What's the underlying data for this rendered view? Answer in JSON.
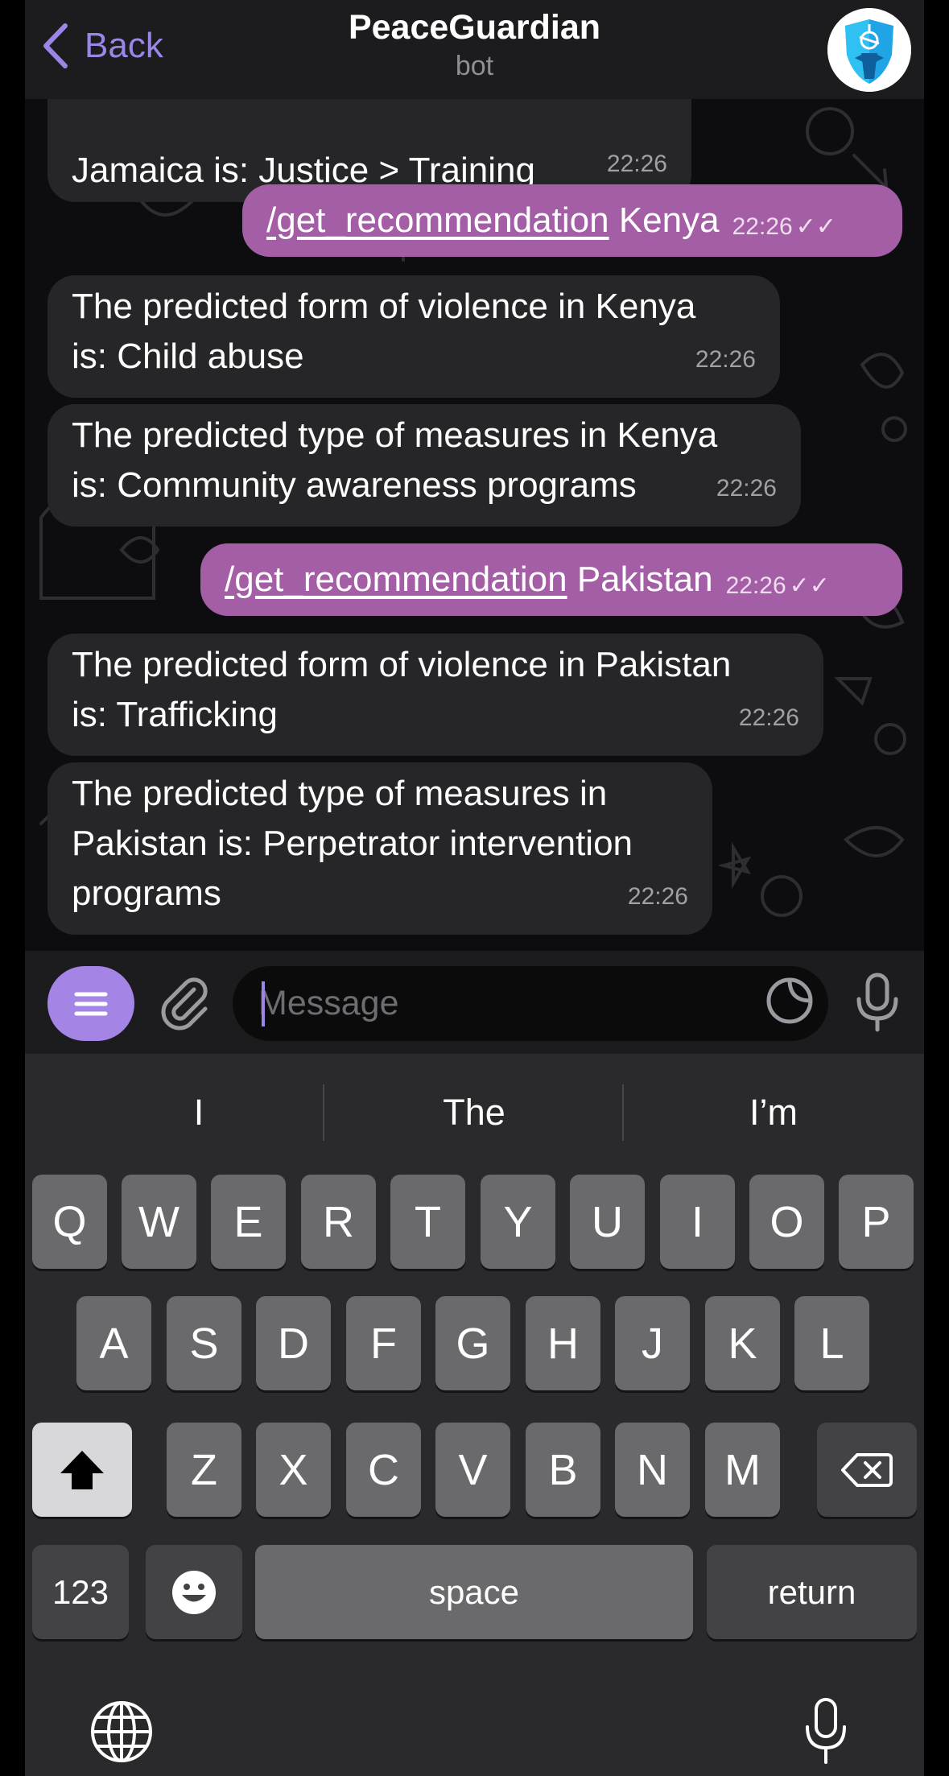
{
  "header": {
    "back_label": "Back",
    "title": "PeaceGuardian",
    "subtitle": "bot"
  },
  "messages": [
    {
      "kind": "in",
      "text": "Jamaica is: Justice > Training",
      "time": "22:26"
    },
    {
      "kind": "out",
      "command": "/get_recommendation",
      "arg": " Kenya",
      "time": "22:26"
    },
    {
      "kind": "in",
      "line1": "The predicted form of violence in Kenya",
      "line2": "is: Child abuse",
      "time": "22:26"
    },
    {
      "kind": "in",
      "line1": "The predicted type of measures in Kenya",
      "line2": "is: Community awareness programs",
      "time": "22:26"
    },
    {
      "kind": "out",
      "command": "/get_recommendation",
      "arg": " Pakistan",
      "time": "22:26"
    },
    {
      "kind": "in",
      "line1": "The predicted form of violence in Pakistan",
      "line2": "is: Trafficking",
      "time": "22:26"
    },
    {
      "kind": "in",
      "line1": "The predicted type of measures in",
      "line2": "Pakistan is: Perpetrator intervention",
      "line3": "programs",
      "time": "22:26"
    }
  ],
  "input": {
    "placeholder": "Message"
  },
  "keyboard": {
    "suggestions": [
      "I",
      "The",
      "I’m"
    ],
    "row1": [
      "Q",
      "W",
      "E",
      "R",
      "T",
      "Y",
      "U",
      "I",
      "O",
      "P"
    ],
    "row2": [
      "A",
      "S",
      "D",
      "F",
      "G",
      "H",
      "J",
      "K",
      "L"
    ],
    "row3": [
      "Z",
      "X",
      "C",
      "V",
      "B",
      "N",
      "M"
    ],
    "numbers_label": "123",
    "space_label": "space",
    "return_label": "return"
  },
  "colors": {
    "accent": "#9b86e8",
    "outgoing_bubble": "#a35ea6",
    "incoming_bubble": "#262628"
  },
  "icons": {
    "double_check": "✓✓"
  }
}
